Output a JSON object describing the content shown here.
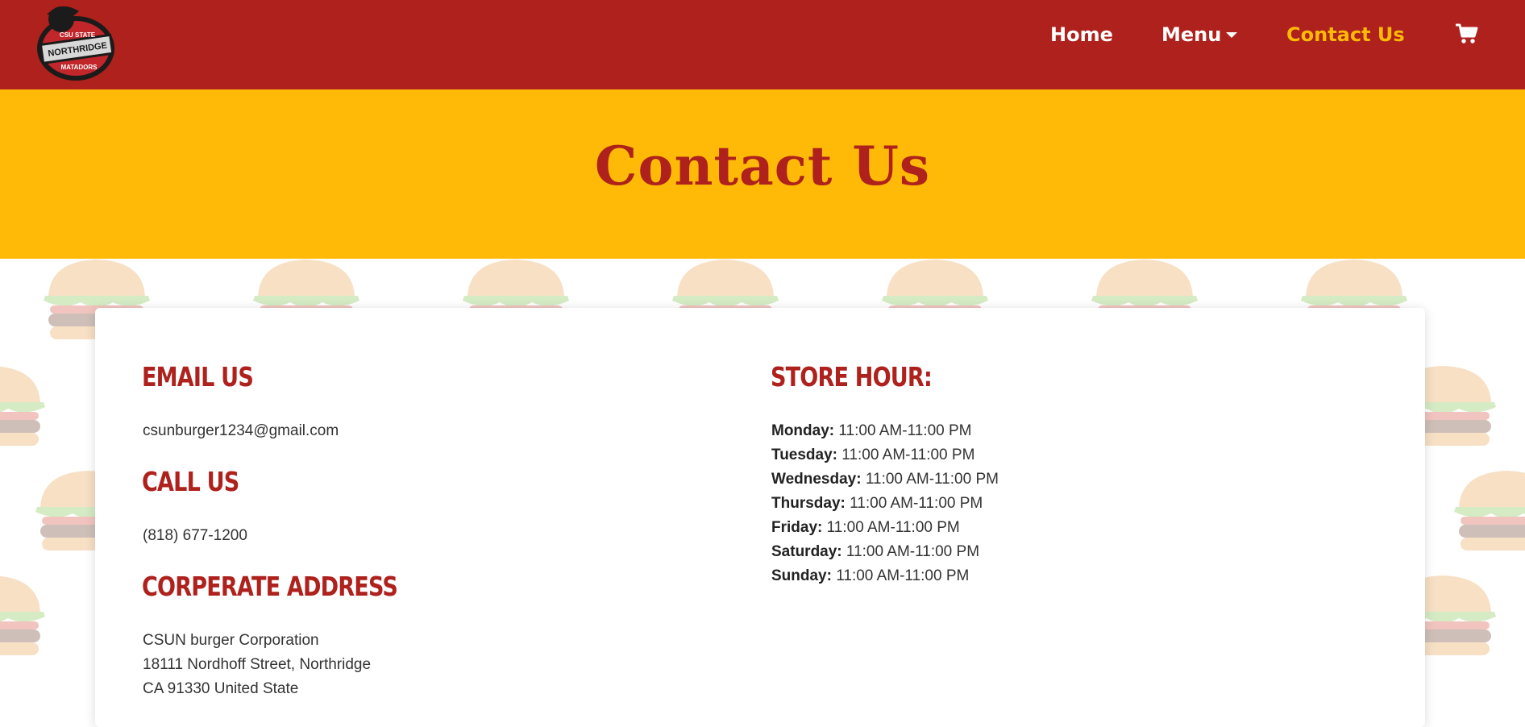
{
  "nav": {
    "home": "Home",
    "menu": "Menu",
    "contact": "Contact Us",
    "logo_text": [
      "CSU STATE",
      "NORTHRIDGE",
      "MATADORS"
    ]
  },
  "hero": {
    "title": "Contact Us"
  },
  "email": {
    "heading": "Email Us",
    "value": "csunburger1234@gmail.com"
  },
  "call": {
    "heading": "Call Us",
    "value": "(818) 677-1200"
  },
  "address": {
    "heading": "Corperate Address",
    "lines": [
      "CSUN burger Corporation",
      "18111 Nordhoff Street, Northridge",
      "CA 91330 United State"
    ]
  },
  "hours": {
    "heading": "Store Hour:",
    "days": [
      {
        "day": "Monday:",
        "time": "11:00 AM-11:00 PM"
      },
      {
        "day": "Tuesday:",
        "time": "11:00 AM-11:00 PM"
      },
      {
        "day": "Wednesday:",
        "time": "11:00 AM-11:00 PM"
      },
      {
        "day": "Thursday:",
        "time": "11:00 AM-11:00 PM"
      },
      {
        "day": "Friday:",
        "time": "11:00 AM-11:00 PM"
      },
      {
        "day": "Saturday:",
        "time": "11:00 AM-11:00 PM"
      },
      {
        "day": "Sunday:",
        "time": "11:00 AM-11:00 PM"
      }
    ]
  },
  "icons": {
    "cart": "cart-icon",
    "caret": "caret-down-icon",
    "burger": "burger-icon"
  },
  "colors": {
    "brand_red": "#ae211c",
    "brand_yellow": "#ffba08"
  }
}
